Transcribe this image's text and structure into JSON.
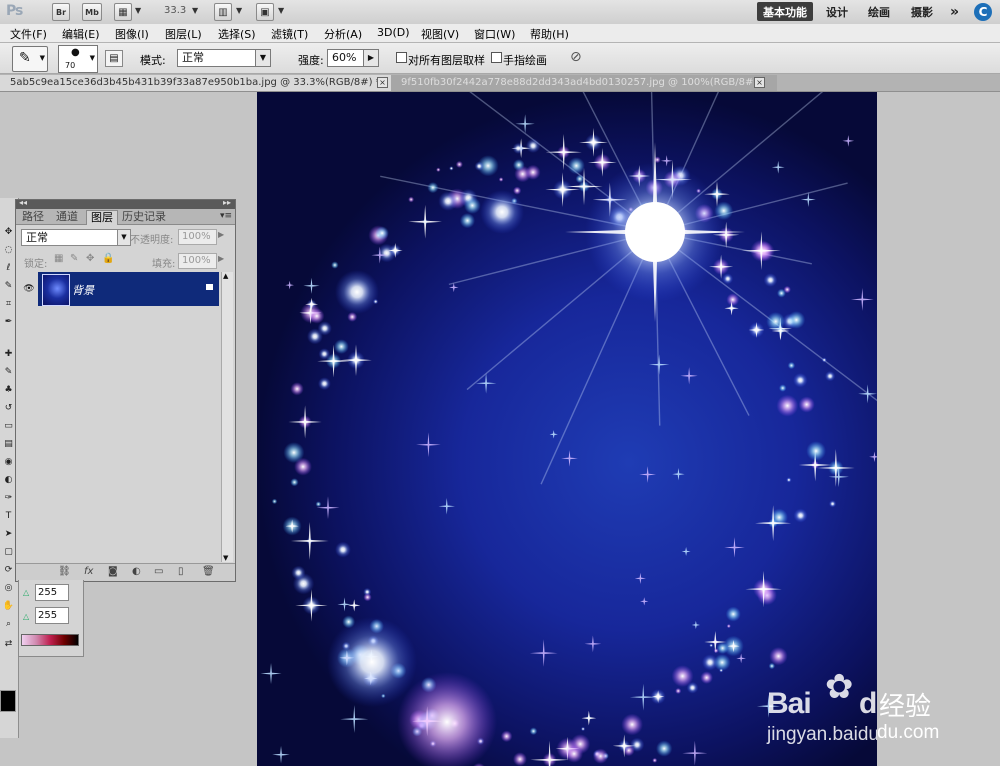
{
  "app": {
    "logo": "Ps",
    "bridge_label": "Br",
    "minibridge_label": "Mb",
    "zoom": "33.3",
    "workspaces": [
      "基本功能",
      "设计",
      "绘画",
      "摄影"
    ],
    "active_workspace": "基本功能",
    "more_label": "»",
    "cs_live": "C"
  },
  "menu": [
    "文件(F)",
    "编辑(E)",
    "图像(I)",
    "图层(L)",
    "选择(S)",
    "滤镜(T)",
    "分析(A)",
    "3D(D)",
    "视图(V)",
    "窗口(W)",
    "帮助(H)"
  ],
  "options": {
    "brush_size": "70",
    "mode_label": "模式:",
    "mode_value": "正常",
    "strength_label": "强度:",
    "strength_value": "60%",
    "sample_all_label": "对所有图层取样",
    "finger_paint_label": "手指绘画"
  },
  "tabs": [
    {
      "title": "5ab5c9ea15ce36d3b45b431b39f33a87e950b1ba.jpg @ 33.3%(RGB/8#) *",
      "active": true
    },
    {
      "title": "9f510fb30f2442a778e88d2dd343ad4bd0130257.jpg @ 100%(RGB/8#)",
      "active": false
    }
  ],
  "layers_panel": {
    "tabs": [
      "路径",
      "通道",
      "图层",
      "历史记录"
    ],
    "active_tab": "图层",
    "blend_mode": "正常",
    "opacity_label": "不透明度:",
    "opacity_value": "100%",
    "lock_label": "锁定:",
    "fill_label": "填充:",
    "fill_value": "100%",
    "layer_name": "背景"
  },
  "color_panel": {
    "value_1": "255",
    "value_2": "255"
  },
  "watermark": {
    "brand": "Bai",
    "brand2": "du",
    "brand_cn": "经验",
    "url": "jingyan.baidu.com"
  },
  "colors": {
    "canvas_bg": "#17279a",
    "active_layer": "#0f2a7a",
    "workspace_active": "#3d3d3d"
  }
}
